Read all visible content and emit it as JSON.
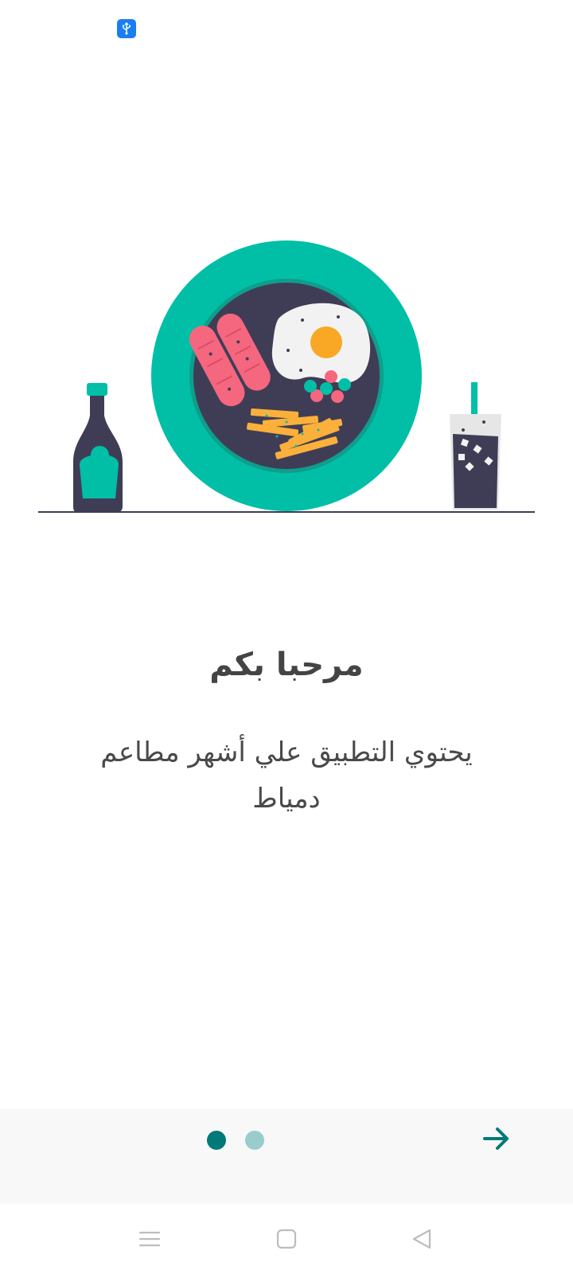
{
  "status_bar": {
    "icons": [
      "usb-icon"
    ]
  },
  "onboarding": {
    "title": "مرحبا بكم",
    "description": "يحتوي التطبيق علي أشهر مطاعم دمياط",
    "page_indicator": {
      "total_pages": 2,
      "current_page": 1
    },
    "next_button_icon": "arrow-right-icon"
  },
  "navigation_bar": {
    "icons": [
      "menu-icon",
      "home-square-icon",
      "back-triangle-icon"
    ]
  },
  "colors": {
    "accent": "#007a78",
    "accent_light": "#98cdcb",
    "plate_green": "#00bfa6",
    "dark_navy": "#3f3d56",
    "sausage_pink": "#f4677f",
    "yolk_orange": "#f9a825",
    "fries_orange": "#fbb03b",
    "usb_blue": "#1a7ef2"
  }
}
